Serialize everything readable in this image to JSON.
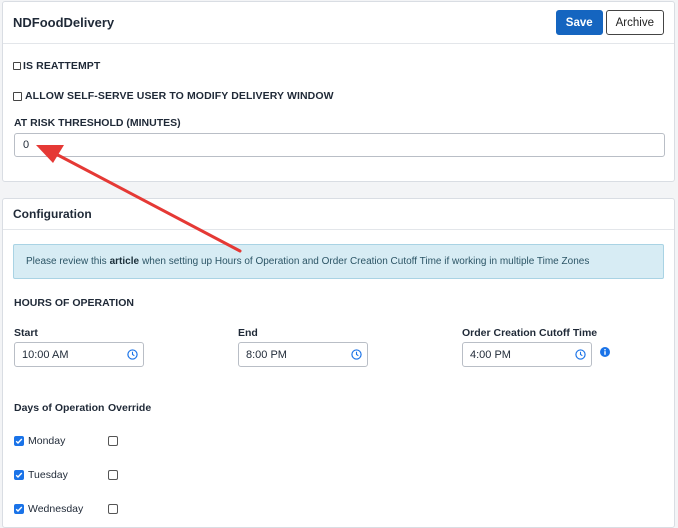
{
  "header": {
    "title": "NDFoodDelivery",
    "save_label": "Save",
    "archive_label": "Archive"
  },
  "settings": {
    "is_reattempt_label": "IS REATTEMPT",
    "allow_self_serve_label": "ALLOW SELF-SERVE USER TO MODIFY DELIVERY WINDOW",
    "at_risk_label": "AT RISK THRESHOLD (MINUTES)",
    "at_risk_value": "0"
  },
  "configuration": {
    "title": "Configuration",
    "info_prefix": "Please review this",
    "info_link": "article",
    "info_suffix": "when setting up Hours of Operation and Order Creation Cutoff Time if working in multiple Time Zones",
    "hours_heading": "HOURS OF OPERATION",
    "start_label": "Start",
    "start_value": "10:00 AM",
    "end_label": "End",
    "end_value": "8:00 PM",
    "cutoff_label": "Order Creation Cutoff Time",
    "cutoff_value": "4:00 PM",
    "days_heading": "Days of Operation",
    "override_heading": "Override",
    "days": [
      {
        "name": "Monday",
        "checked": true,
        "override": false
      },
      {
        "name": "Tuesday",
        "checked": true,
        "override": false
      },
      {
        "name": "Wednesday",
        "checked": true,
        "override": false
      }
    ]
  },
  "colors": {
    "accent": "#1565c0",
    "checkbox": "#1a73e8",
    "info_bg": "#d7ecf4",
    "annotation_arrow": "#e53935"
  }
}
